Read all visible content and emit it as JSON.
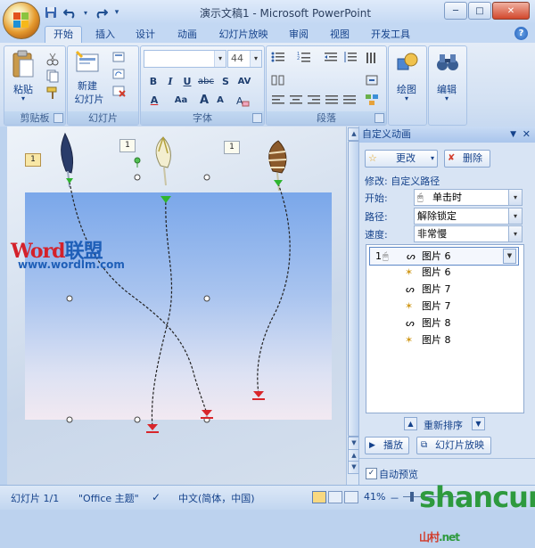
{
  "window": {
    "title": "演示文稿1 - Microsoft PowerPoint",
    "minimize_label": "─",
    "maximize_label": "□",
    "close_label": "✕"
  },
  "quick_access": {
    "save_icon": "save-icon",
    "undo_icon": "undo-icon",
    "redo_icon": "redo-icon",
    "customize_icon": "dropdown-icon"
  },
  "tabs": [
    {
      "label": "开始",
      "active": true
    },
    {
      "label": "插入"
    },
    {
      "label": "设计"
    },
    {
      "label": "动画"
    },
    {
      "label": "幻灯片放映"
    },
    {
      "label": "审阅"
    },
    {
      "label": "视图"
    },
    {
      "label": "开发工具"
    }
  ],
  "help_label": "?",
  "ribbon": {
    "clipboard": {
      "label": "剪贴板",
      "paste": "粘贴"
    },
    "slides": {
      "label": "幻灯片",
      "new_slide_line1": "新建",
      "new_slide_line2": "幻灯片"
    },
    "font": {
      "label": "字体",
      "font_size": "44",
      "bold": "B",
      "italic": "I",
      "underline": "U",
      "strike": "abc",
      "shadow": "S",
      "spacing": "AV",
      "size_up": "A",
      "aa": "Aa",
      "font_color": "A"
    },
    "paragraph": {
      "label": "段落"
    },
    "drawing": {
      "label": "绘图"
    },
    "editing": {
      "label": "编辑"
    }
  },
  "slide": {
    "watermark_word": "Word",
    "watermark_cn": "联盟",
    "watermark_url": "www.wordlm.com",
    "tags": [
      "1",
      "1",
      "1"
    ]
  },
  "task_pane": {
    "title": "自定义动画",
    "change_button": "更改",
    "delete_button": "删除",
    "modify_label": "修改: 自定义路径",
    "start_label": "开始:",
    "start_value": "单击时",
    "path_label": "路径:",
    "path_value": "解除锁定",
    "speed_label": "速度:",
    "speed_value": "非常慢",
    "items": [
      {
        "num": "1",
        "icon": "path-icon",
        "name": "图片 6",
        "selected": true
      },
      {
        "num": "",
        "icon": "emphasis-icon",
        "name": "图片 6"
      },
      {
        "num": "",
        "icon": "path-icon",
        "name": "图片 7"
      },
      {
        "num": "",
        "icon": "emphasis-icon",
        "name": "图片 7"
      },
      {
        "num": "",
        "icon": "path-icon",
        "name": "图片 8"
      },
      {
        "num": "",
        "icon": "emphasis-icon",
        "name": "图片 8"
      }
    ],
    "reorder_label": "重新排序",
    "play_button": "播放",
    "slideshow_button": "幻灯片放映",
    "autopreview_label": "自动预览",
    "autopreview_checked": true
  },
  "status_bar": {
    "slide_count": "幻灯片 1/1",
    "theme": "\"Office 主题\"",
    "language": "中文(简体，中国)",
    "zoom": "41%",
    "minus": "－"
  },
  "site_watermark": {
    "main": "shancun",
    "sub": "山村",
    "tld": ".net"
  }
}
